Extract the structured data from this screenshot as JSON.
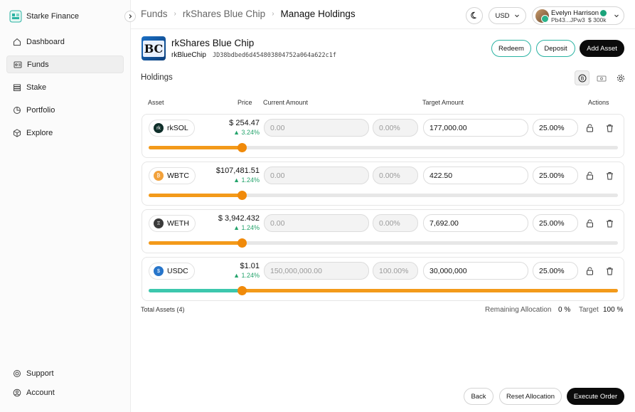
{
  "brand": {
    "name": "Starke Finance"
  },
  "sidebar": {
    "items": [
      {
        "label": "Dashboard",
        "icon": "home-icon"
      },
      {
        "label": "Funds",
        "icon": "funds-icon"
      },
      {
        "label": "Stake",
        "icon": "stack-icon"
      },
      {
        "label": "Portfolio",
        "icon": "pie-icon"
      },
      {
        "label": "Explore",
        "icon": "cube-icon"
      }
    ],
    "bottom": [
      {
        "label": "Support",
        "icon": "support-icon"
      },
      {
        "label": "Account",
        "icon": "account-icon"
      }
    ],
    "active": "Funds"
  },
  "breadcrumb": {
    "items": [
      "Funds",
      "rkShares Blue Chip",
      "Manage Holdings"
    ]
  },
  "header": {
    "currency": "USD",
    "user": {
      "name": "Evelyn Harrison",
      "address": "Pb43...JPw3",
      "balance": "$ 300k"
    }
  },
  "fund": {
    "logo_text": "BC",
    "name": "rkShares Blue Chip",
    "ticker": "rkBlueChip",
    "address": "JD38bdbed6d454803804752a064a622c1f",
    "redeem_label": "Redeem",
    "deposit_label": "Deposit",
    "add_asset_label": "Add Asset"
  },
  "holdings": {
    "title": "Holdings",
    "columns": {
      "asset": "Asset",
      "price": "Price",
      "current": "Current Amount",
      "target": "Target Amount",
      "actions": "Actions"
    },
    "rows": [
      {
        "symbol": "rkSOL",
        "price": "$ 254.47",
        "change": "▲ 3.24%",
        "current_amount": "0.00",
        "current_pct": "0.00%",
        "target_amount": "177,000.00",
        "target_pct": "25.00%",
        "current_share": 0.0,
        "target_share": 0.25,
        "icon_color": "#0f2f2a"
      },
      {
        "symbol": "WBTC",
        "price": "$107,481.51",
        "change": "▲ 1.24%",
        "current_amount": "0.00",
        "current_pct": "0.00%",
        "target_amount": "422.50",
        "target_pct": "25.00%",
        "current_share": 0.0,
        "target_share": 0.25,
        "icon_color": "#f2a13a"
      },
      {
        "symbol": "WETH",
        "price": "$ 3,942.432",
        "change": "▲ 1.24%",
        "current_amount": "0.00",
        "current_pct": "0.00%",
        "target_amount": "7,692.00",
        "target_pct": "25.00%",
        "current_share": 0.0,
        "target_share": 0.25,
        "icon_color": "#3a3a3a"
      },
      {
        "symbol": "USDC",
        "price": "$1.01",
        "change": "▲ 1.24%",
        "current_amount": "150,000,000.00",
        "current_pct": "100.00%",
        "target_amount": "30,000,000",
        "target_pct": "25.00%",
        "current_share": 1.0,
        "target_share": 0.25,
        "icon_color": "#2775ca"
      }
    ],
    "total_label": "Total Assets (4)",
    "remaining_label": "Remaining Allocation",
    "remaining_value": "0 %",
    "target_label": "Target",
    "target_value": "100 %"
  },
  "footer": {
    "back_label": "Back",
    "reset_label": "Reset Allocation",
    "execute_label": "Execute Order"
  },
  "colors": {
    "accent_teal": "#2bb3a3",
    "orange": "#f39a1a",
    "positive": "#23a36b"
  }
}
